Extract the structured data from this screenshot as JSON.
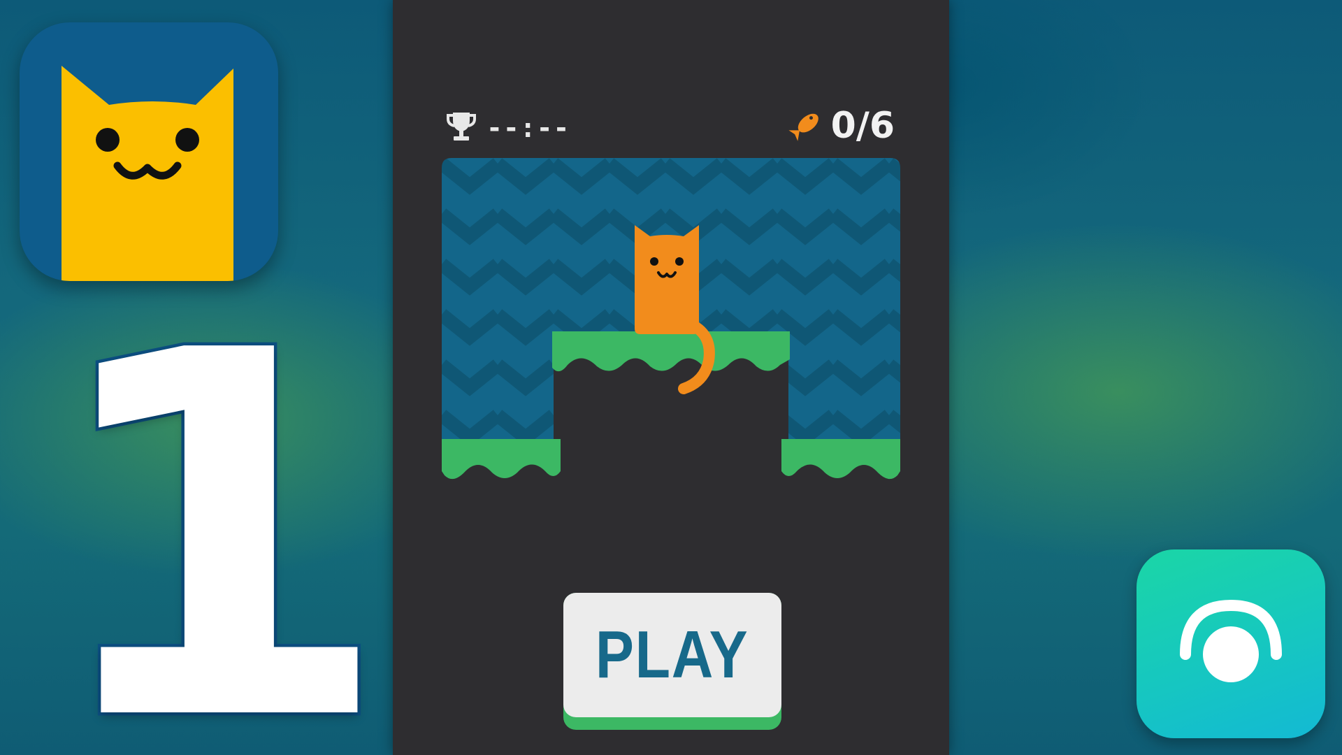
{
  "thumbnail": {
    "episode_number": "1"
  },
  "game": {
    "hud": {
      "best_time": "--:--",
      "fish_collected": "0/6"
    },
    "play_button_label": "PLAY"
  },
  "colors": {
    "cat": "#f28c1c",
    "cat_face_icon": "#fbbf00",
    "grass": "#3cb864",
    "wall": "#13668a",
    "background_dark": "#2e2d30",
    "channel_icon": "#16c7c0"
  },
  "icons": {
    "best_time": "trophy-icon",
    "fish_counter": "fish-icon",
    "app_icon": "cat-app-icon",
    "channel_icon": "camera-channel-icon"
  }
}
